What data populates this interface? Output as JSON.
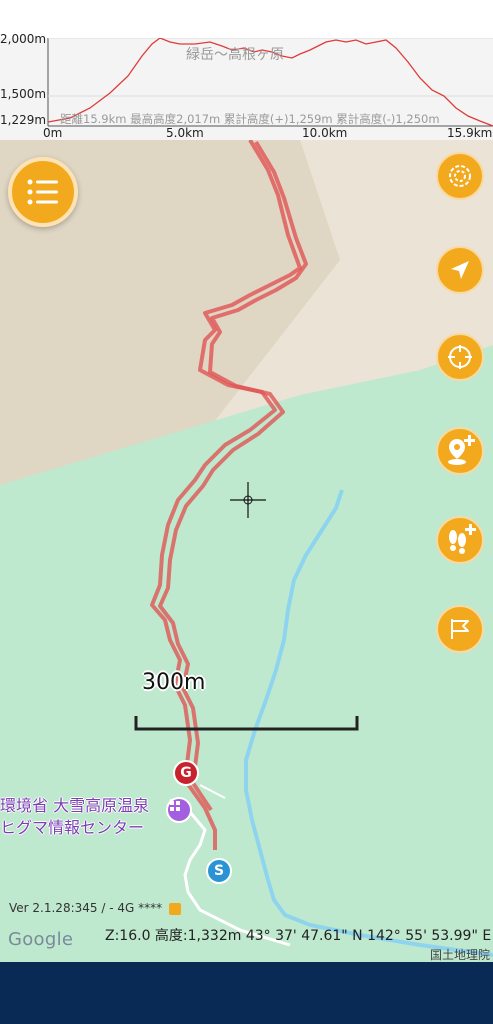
{
  "profile": {
    "elevation_labels": [
      "2,000m",
      "1,500m",
      "1,229m"
    ],
    "x_labels": [
      "0m",
      "5.0km",
      "10.0km",
      "15.9km"
    ],
    "route_name": "緑岳～高根ヶ原",
    "stats": "距離15.9km  最高高度2,017m  累計高度(+)1,259m  累計高度(-)1,250m"
  },
  "map": {
    "scale_label": "300m",
    "goal_marker": "G",
    "start_marker": "S",
    "poi_label_line1": "環境省 大雪高原温泉",
    "poi_label_line2": "ヒグマ情報センター"
  },
  "toolbar": {
    "menu_icon": "list-icon",
    "buttons": [
      "target-spiral-icon",
      "navigation-arrow-icon",
      "crosshair-target-icon",
      "add-pin-icon",
      "add-footprints-icon",
      "flag-icon"
    ]
  },
  "footer": {
    "version": "Ver 2.1.28:345 / - 4G ****",
    "google": "Google",
    "status": "Z:16.0  高度:1,332m  43° 37' 47.61\" N 142° 55' 53.99\" E",
    "attribution": "国土地理院"
  },
  "colors": {
    "accent": "#f3a91d",
    "route": "#e05555",
    "navbar": "#0a2a56"
  }
}
